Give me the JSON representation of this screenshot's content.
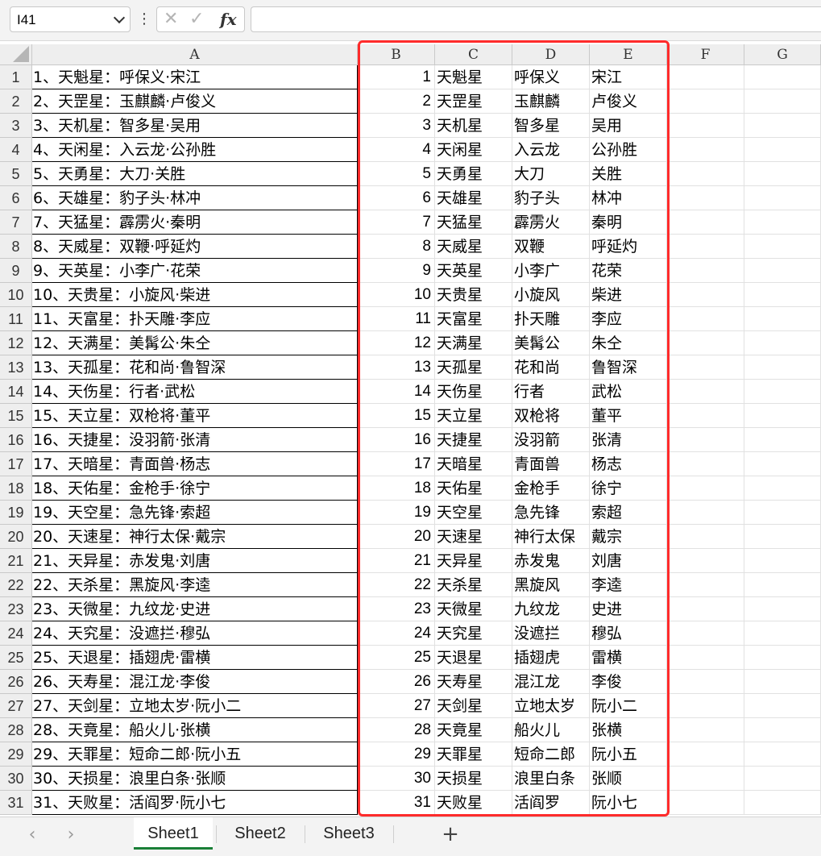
{
  "toolbar": {
    "namebox_value": "I41",
    "kebab": "⋮",
    "cancel_glyph": "✕",
    "confirm_glyph": "✓",
    "fx_label": "fx",
    "formula_value": ""
  },
  "columns": [
    "A",
    "B",
    "C",
    "D",
    "E",
    "F",
    "G"
  ],
  "rows": [
    {
      "n": "1",
      "a": "1、天魁星：呼保义·宋江",
      "b": "1",
      "c": "天魁星",
      "d": "呼保义",
      "e": "宋江"
    },
    {
      "n": "2",
      "a": "2、天罡星：玉麒麟·卢俊义",
      "b": "2",
      "c": "天罡星",
      "d": "玉麒麟",
      "e": "卢俊义"
    },
    {
      "n": "3",
      "a": "3、天机星：智多星·吴用",
      "b": "3",
      "c": "天机星",
      "d": "智多星",
      "e": "吴用"
    },
    {
      "n": "4",
      "a": "4、天闲星：入云龙·公孙胜",
      "b": "4",
      "c": "天闲星",
      "d": "入云龙",
      "e": "公孙胜"
    },
    {
      "n": "5",
      "a": "5、天勇星：大刀·关胜",
      "b": "5",
      "c": "天勇星",
      "d": "大刀",
      "e": "关胜"
    },
    {
      "n": "6",
      "a": "6、天雄星：豹子头·林冲",
      "b": "6",
      "c": "天雄星",
      "d": "豹子头",
      "e": "林冲"
    },
    {
      "n": "7",
      "a": "7、天猛星：霹雳火·秦明",
      "b": "7",
      "c": "天猛星",
      "d": "霹雳火",
      "e": "秦明"
    },
    {
      "n": "8",
      "a": "8、天威星：双鞭·呼延灼",
      "b": "8",
      "c": "天威星",
      "d": "双鞭",
      "e": "呼延灼"
    },
    {
      "n": "9",
      "a": "9、天英星：小李广·花荣",
      "b": "9",
      "c": "天英星",
      "d": "小李广",
      "e": "花荣"
    },
    {
      "n": "10",
      "a": "10、天贵星：小旋风·柴进",
      "b": "10",
      "c": "天贵星",
      "d": "小旋风",
      "e": "柴进"
    },
    {
      "n": "11",
      "a": "11、天富星：扑天雕·李应",
      "b": "11",
      "c": "天富星",
      "d": "扑天雕",
      "e": "李应"
    },
    {
      "n": "12",
      "a": "12、天满星：美髯公·朱仝",
      "b": "12",
      "c": "天满星",
      "d": "美髯公",
      "e": "朱仝"
    },
    {
      "n": "13",
      "a": "13、天孤星：花和尚·鲁智深",
      "b": "13",
      "c": "天孤星",
      "d": "花和尚",
      "e": "鲁智深"
    },
    {
      "n": "14",
      "a": "14、天伤星：行者·武松",
      "b": "14",
      "c": "天伤星",
      "d": "行者",
      "e": "武松"
    },
    {
      "n": "15",
      "a": "15、天立星：双枪将·董平",
      "b": "15",
      "c": "天立星",
      "d": "双枪将",
      "e": "董平"
    },
    {
      "n": "16",
      "a": "16、天捷星：没羽箭·张清",
      "b": "16",
      "c": "天捷星",
      "d": "没羽箭",
      "e": "张清"
    },
    {
      "n": "17",
      "a": "17、天暗星：青面兽·杨志",
      "b": "17",
      "c": "天暗星",
      "d": "青面兽",
      "e": "杨志"
    },
    {
      "n": "18",
      "a": "18、天佑星：金枪手·徐宁",
      "b": "18",
      "c": "天佑星",
      "d": "金枪手",
      "e": "徐宁"
    },
    {
      "n": "19",
      "a": "19、天空星：急先锋·索超",
      "b": "19",
      "c": "天空星",
      "d": "急先锋",
      "e": "索超"
    },
    {
      "n": "20",
      "a": "20、天速星：神行太保·戴宗",
      "b": "20",
      "c": "天速星",
      "d": "神行太保",
      "e": "戴宗"
    },
    {
      "n": "21",
      "a": "21、天异星：赤发鬼·刘唐",
      "b": "21",
      "c": "天异星",
      "d": "赤发鬼",
      "e": "刘唐"
    },
    {
      "n": "22",
      "a": "22、天杀星：黑旋风·李逵",
      "b": "22",
      "c": "天杀星",
      "d": "黑旋风",
      "e": "李逵"
    },
    {
      "n": "23",
      "a": "23、天微星：九纹龙·史进",
      "b": "23",
      "c": "天微星",
      "d": "九纹龙",
      "e": "史进"
    },
    {
      "n": "24",
      "a": "24、天究星：没遮拦·穆弘",
      "b": "24",
      "c": "天究星",
      "d": "没遮拦",
      "e": "穆弘"
    },
    {
      "n": "25",
      "a": "25、天退星：插翅虎·雷横",
      "b": "25",
      "c": "天退星",
      "d": "插翅虎",
      "e": "雷横"
    },
    {
      "n": "26",
      "a": "26、天寿星：混江龙·李俊",
      "b": "26",
      "c": "天寿星",
      "d": "混江龙",
      "e": "李俊"
    },
    {
      "n": "27",
      "a": "27、天剑星：立地太岁·阮小二",
      "b": "27",
      "c": "天剑星",
      "d": "立地太岁",
      "e": "阮小二"
    },
    {
      "n": "28",
      "a": "28、天竟星：船火儿·张横",
      "b": "28",
      "c": "天竟星",
      "d": "船火儿",
      "e": "张横"
    },
    {
      "n": "29",
      "a": "29、天罪星：短命二郎·阮小五",
      "b": "29",
      "c": "天罪星",
      "d": "短命二郎",
      "e": "阮小五"
    },
    {
      "n": "30",
      "a": "30、天损星：浪里白条·张顺",
      "b": "30",
      "c": "天损星",
      "d": "浪里白条",
      "e": "张顺"
    },
    {
      "n": "31",
      "a": "31、天败星：活阎罗·阮小七",
      "b": "31",
      "c": "天败星",
      "d": "活阎罗",
      "e": "阮小七"
    }
  ],
  "tabs": {
    "prev": "‹",
    "next": "›",
    "sheets": [
      "Sheet1",
      "Sheet2",
      "Sheet3"
    ],
    "active": "Sheet1",
    "add": "+"
  },
  "colors": {
    "highlight": "#ff2b2b",
    "active_tab_underline": "#1a7f37",
    "header_bg": "#eeeeee"
  }
}
